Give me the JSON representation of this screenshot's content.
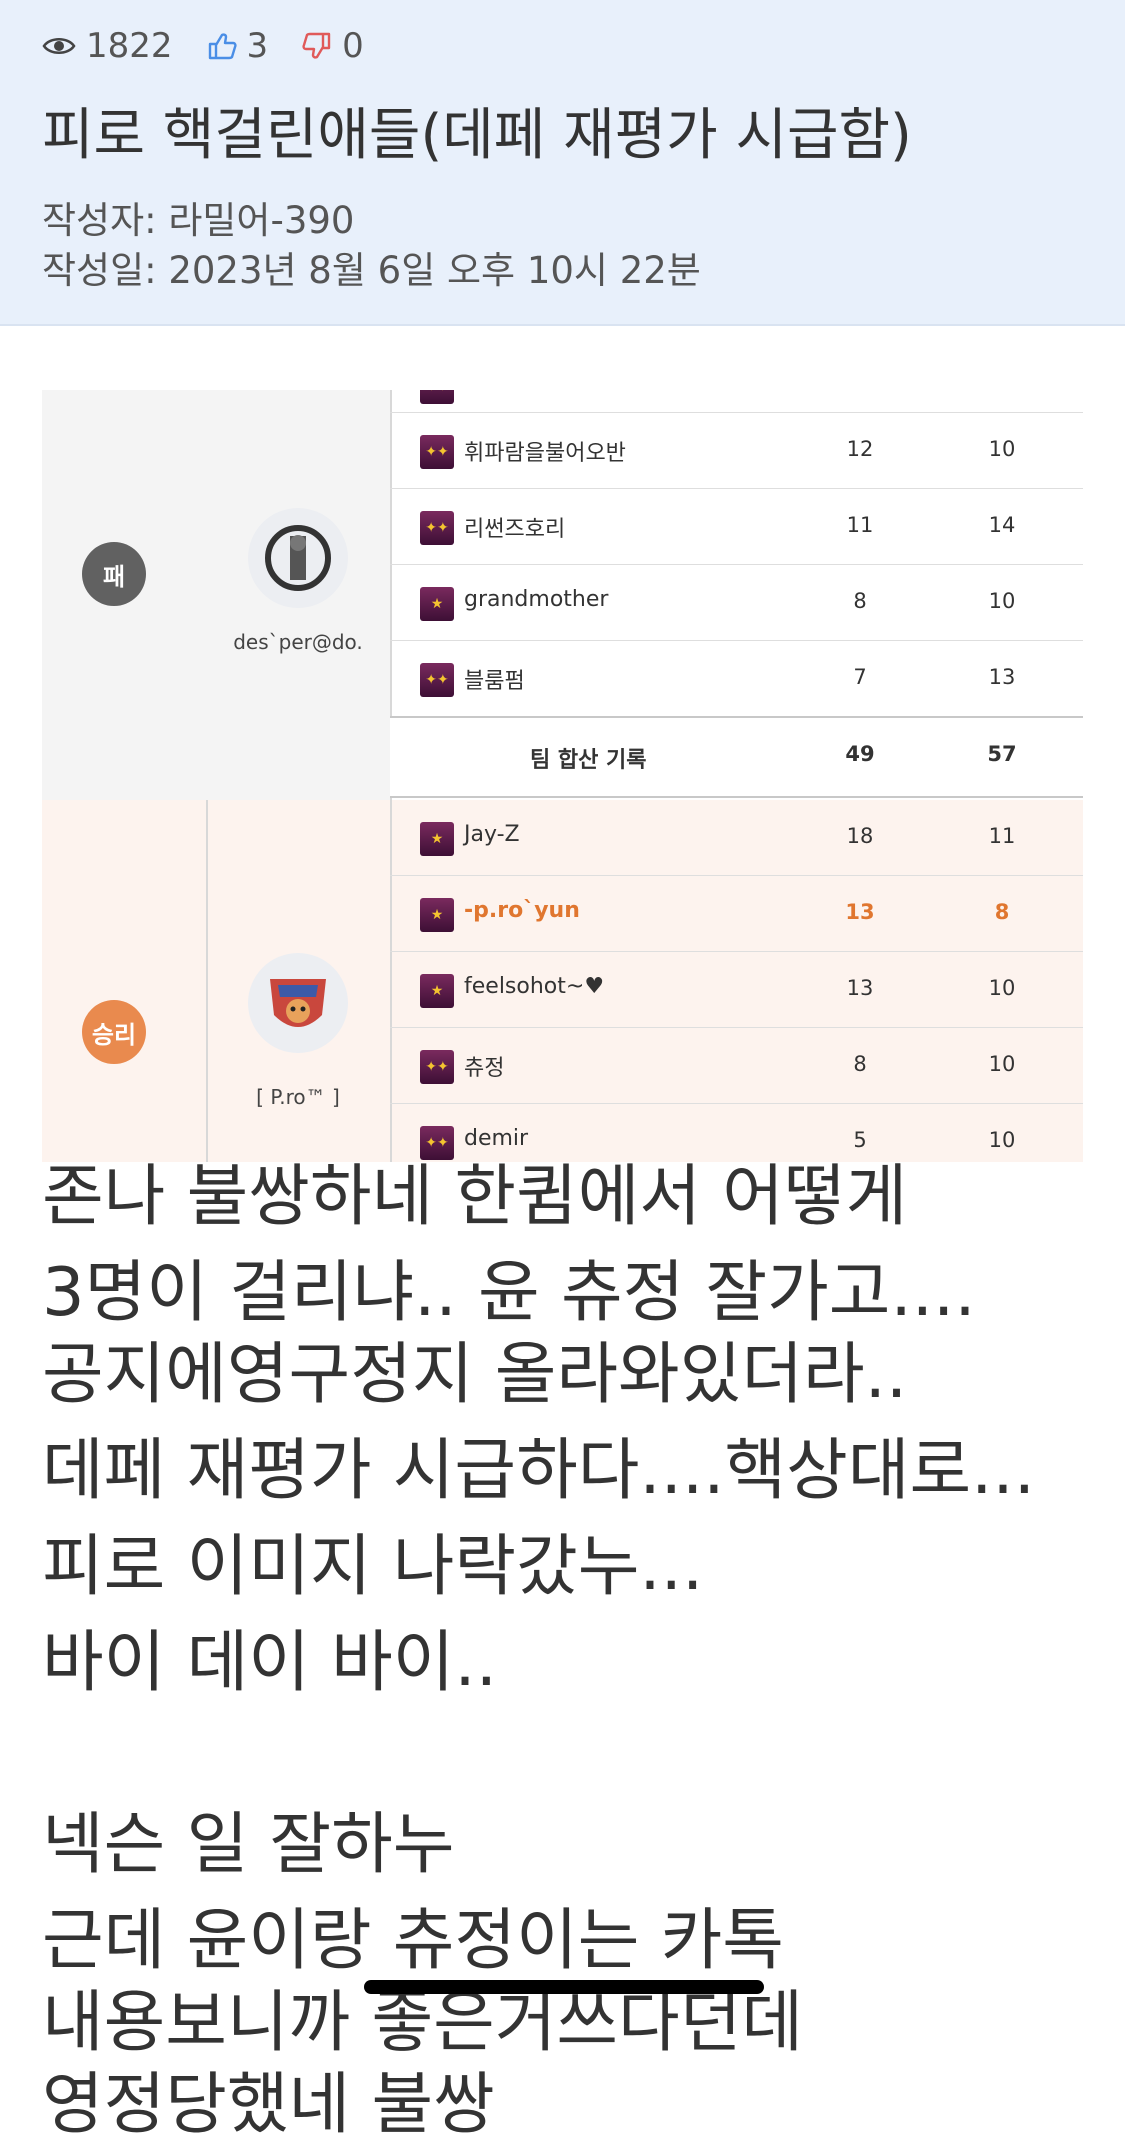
{
  "post": {
    "views": "1822",
    "likes": "3",
    "dislikes": "0",
    "title": "피로 핵걸린애들(데페 재평가 시급함)",
    "author": "작성자: 라밀어-390",
    "date": "작성일: 2023년 8월 6일 오후 10시 22분"
  },
  "match": {
    "lose": {
      "result": "패",
      "team_name": "des`per@do.",
      "players": [
        {
          "name": "",
          "k": "",
          "d": ""
        },
        {
          "name": "휘파람을불어오반",
          "k": "12",
          "d": "10"
        },
        {
          "name": "리썬즈호리",
          "k": "11",
          "d": "14"
        },
        {
          "name": "grandmother",
          "k": "8",
          "d": "10"
        },
        {
          "name": "블룸펌",
          "k": "7",
          "d": "13"
        }
      ],
      "total_label": "팀 합산 기록",
      "total_k": "49",
      "total_d": "57"
    },
    "win": {
      "result": "승리",
      "team_name": "[ P.ro™ ]",
      "players": [
        {
          "name": "Jay-Z",
          "k": "18",
          "d": "11"
        },
        {
          "name": "-p.ro`yun",
          "k": "13",
          "d": "8"
        },
        {
          "name": "feelsohot~♥",
          "k": "13",
          "d": "10"
        },
        {
          "name": "츄정",
          "k": "8",
          "d": "10"
        },
        {
          "name": "demir",
          "k": "5",
          "d": "10"
        }
      ]
    }
  },
  "content": {
    "lines": [
      "존나 불쌍하네 한큄에서 어떻게",
      "3명이 걸리냐.. 윤 츄정 잘가고.... 공지에영구정지 올라와있더라..",
      "데페 재평가 시급하다....핵상대로...",
      "피로 이미지 나락갔누...",
      "바이 데이 바이..",
      "",
      "넥슨 일 잘하누",
      "근데 윤이랑 츄정이는 카톡 내용보니까 좋은거쓰다던데 영정당했네 불쌍"
    ]
  },
  "colors": {
    "header_bg": "#e8f0fb",
    "win_bg": "#fdf3ee",
    "highlight": "#e0762f",
    "like": "#4a8ee6",
    "dislike": "#e05a5a"
  }
}
